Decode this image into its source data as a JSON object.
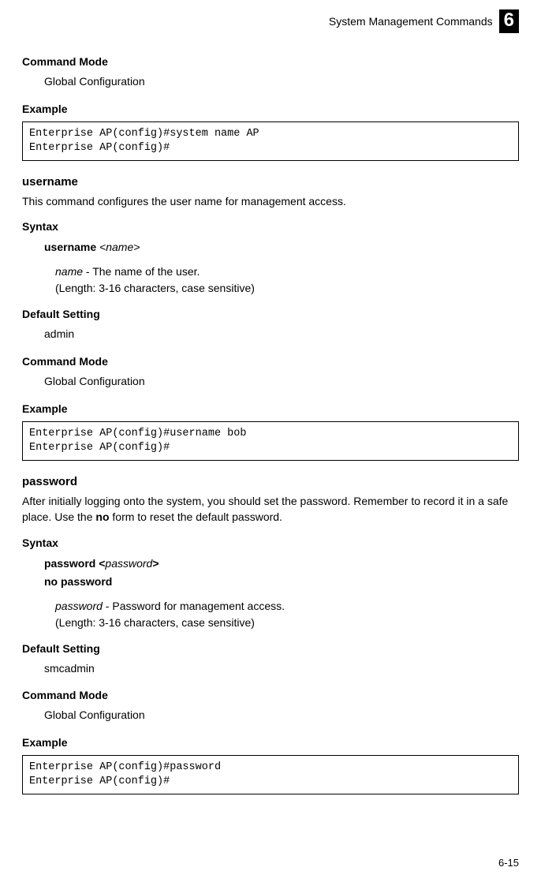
{
  "header": {
    "title": "System Management Commands",
    "chapter": "6"
  },
  "section1": {
    "mode_label": "Command Mode",
    "mode_value": "Global Configuration",
    "example_label": "Example",
    "code": "Enterprise AP(config)#system name AP\nEnterprise AP(config)#"
  },
  "username": {
    "title": "username",
    "desc": "This command configures the user name for management access.",
    "syntax_label": "Syntax",
    "syntax_cmd": "username",
    "syntax_arg": "<name>",
    "param_name": "name",
    "param_desc": " - The name of the user.",
    "param_len": "(Length: 3-16 characters, case sensitive)",
    "default_label": "Default Setting",
    "default_value": "admin",
    "mode_label": "Command Mode",
    "mode_value": "Global Configuration",
    "example_label": "Example",
    "code": "Enterprise AP(config)#username bob\nEnterprise AP(config)#"
  },
  "password": {
    "title": "password",
    "desc_pre": "After initially logging onto the system, you should set the password. Remember to record it in a safe place. Use the ",
    "desc_bold": "no",
    "desc_post": " form to reset the default password.",
    "syntax_label": "Syntax",
    "syntax_cmd1a": "password <",
    "syntax_cmd1b": "password",
    "syntax_cmd1c": ">",
    "syntax_cmd2": "no password",
    "param_name": "password",
    "param_desc": " - Password for management access.",
    "param_len": "(Length: 3-16 characters, case sensitive)",
    "default_label": "Default Setting",
    "default_value": "smcadmin",
    "mode_label": "Command Mode",
    "mode_value": "Global Configuration",
    "example_label": "Example",
    "code": "Enterprise AP(config)#password\nEnterprise AP(config)#"
  },
  "page_number": "6-15"
}
